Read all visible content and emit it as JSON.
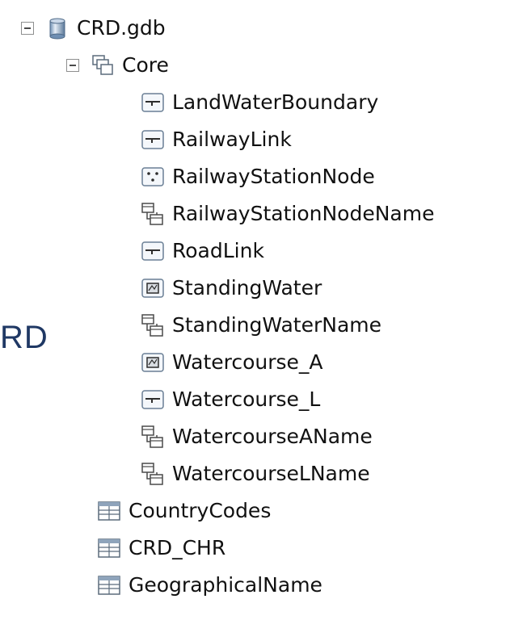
{
  "side_text": "RD",
  "tree": {
    "root": {
      "label": "CRD.gdb",
      "icon": "geodatabase-icon",
      "expanded": true
    },
    "dataset": {
      "label": "Core",
      "icon": "feature-dataset-icon",
      "expanded": true
    },
    "feature_classes": [
      {
        "label": "LandWaterBoundary",
        "icon": "line-feature-class-icon"
      },
      {
        "label": "RailwayLink",
        "icon": "line-feature-class-icon"
      },
      {
        "label": "RailwayStationNode",
        "icon": "point-feature-class-icon"
      },
      {
        "label": "RailwayStationNodeName",
        "icon": "relationship-class-icon"
      },
      {
        "label": "RoadLink",
        "icon": "line-feature-class-icon"
      },
      {
        "label": "StandingWater",
        "icon": "polygon-feature-class-icon"
      },
      {
        "label": "StandingWaterName",
        "icon": "relationship-class-icon"
      },
      {
        "label": "Watercourse_A",
        "icon": "polygon-feature-class-icon"
      },
      {
        "label": "Watercourse_L",
        "icon": "line-feature-class-icon"
      },
      {
        "label": "WatercourseAName",
        "icon": "relationship-class-icon"
      },
      {
        "label": "WatercourseLName",
        "icon": "relationship-class-icon"
      }
    ],
    "tables": [
      {
        "label": "CountryCodes",
        "icon": "table-icon"
      },
      {
        "label": "CRD_CHR",
        "icon": "table-icon"
      },
      {
        "label": "GeographicalName",
        "icon": "table-icon"
      }
    ]
  }
}
